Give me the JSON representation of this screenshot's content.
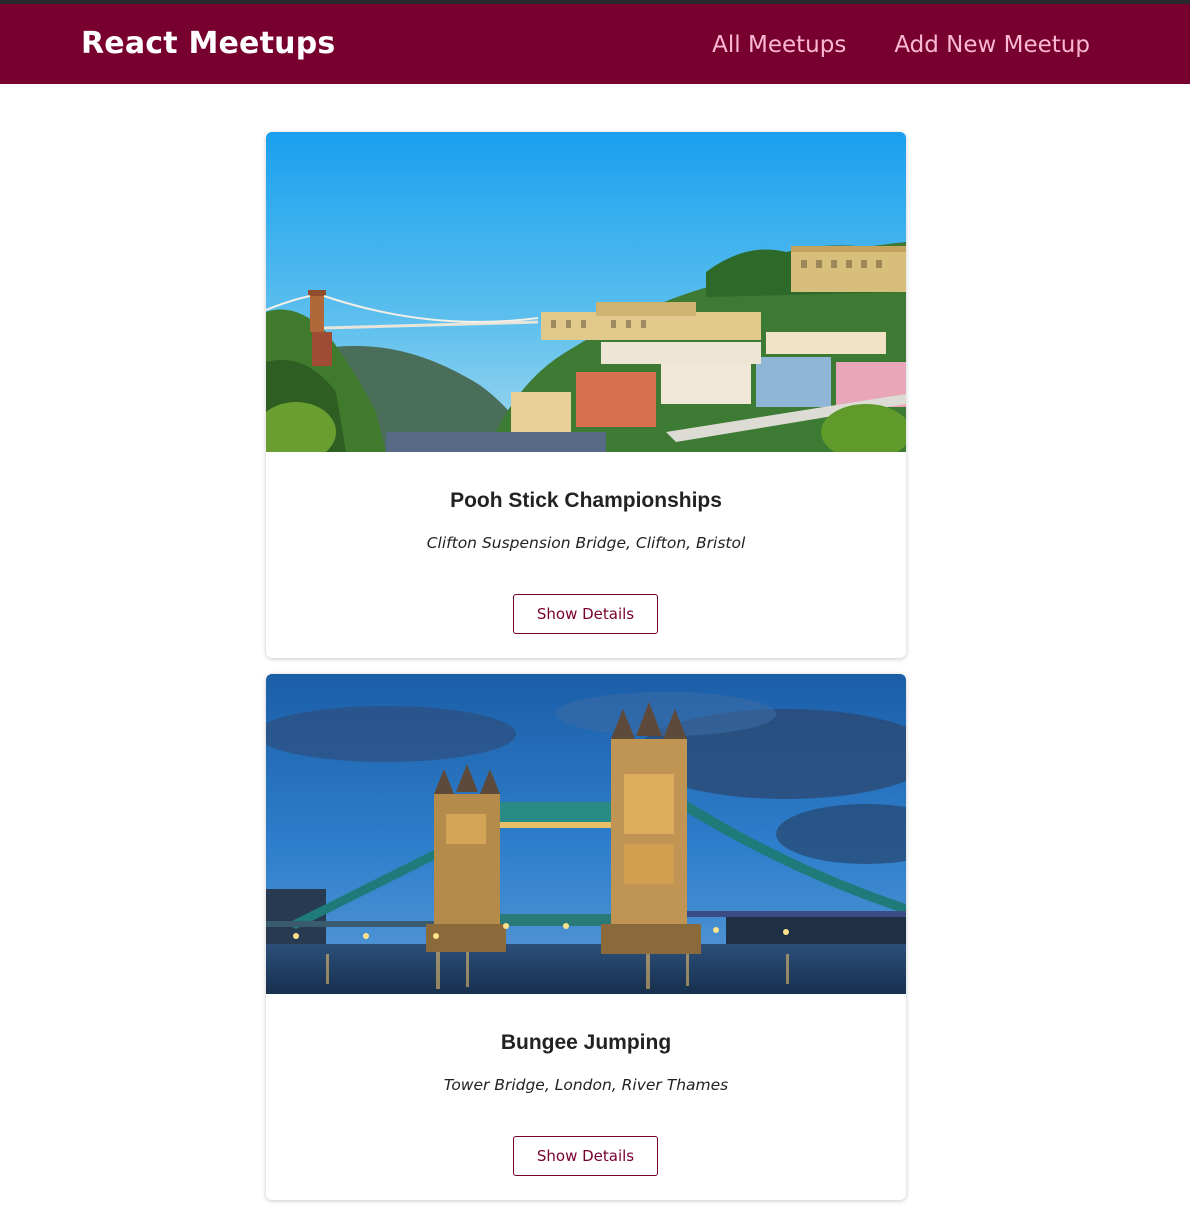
{
  "header": {
    "logo": "React Meetups",
    "nav": [
      {
        "label": "All Meetups"
      },
      {
        "label": "Add New Meetup"
      }
    ]
  },
  "meetups": [
    {
      "title": "Pooh Stick Championships",
      "address": "Clifton Suspension Bridge, Clifton, Bristol",
      "button": "Show Details"
    },
    {
      "title": "Bungee Jumping",
      "address": "Tower Bridge, London, River Thames",
      "button": "Show Details"
    }
  ],
  "colors": {
    "brand": "#77002e",
    "nav_link": "#fcb8d2"
  }
}
